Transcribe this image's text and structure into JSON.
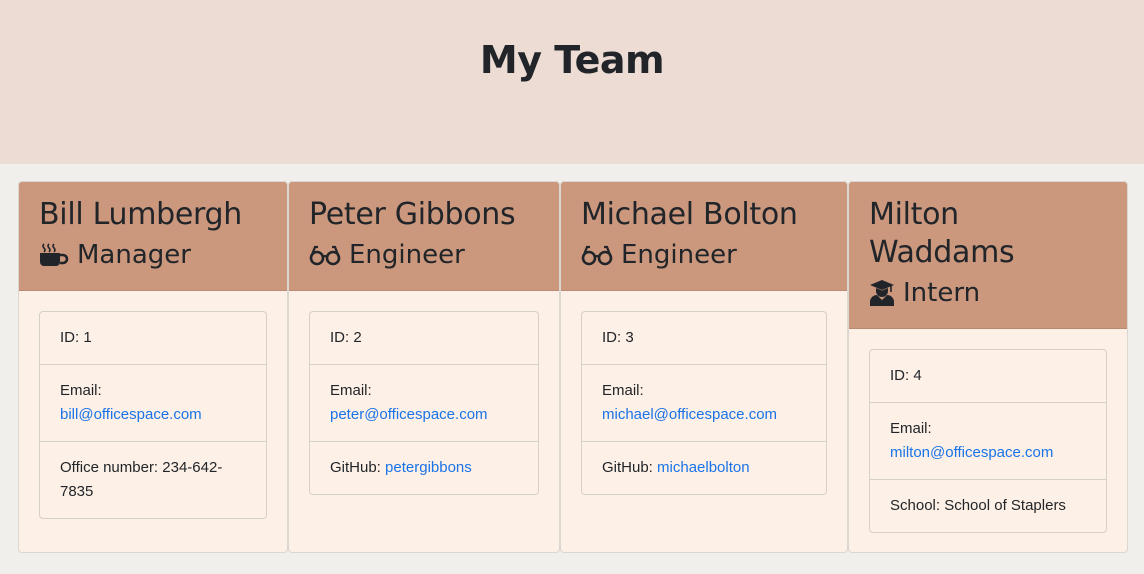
{
  "header": {
    "title": "My Team"
  },
  "cards": [
    {
      "name": "Bill Lumbergh",
      "role": "Manager",
      "role_icon": "coffee-mug-icon",
      "id_text": "ID: 1",
      "email_label": "Email:",
      "email": "bill@officespace.com",
      "extra_label": "Office number: 234-642-7835",
      "extra_link": ""
    },
    {
      "name": "Peter Gibbons",
      "role": "Engineer",
      "role_icon": "glasses-icon",
      "id_text": "ID: 2",
      "email_label": "Email:",
      "email": "peter@officespace.com",
      "extra_label": "GitHub: ",
      "extra_link": "petergibbons"
    },
    {
      "name": "Michael Bolton",
      "role": "Engineer",
      "role_icon": "glasses-icon",
      "id_text": "ID: 3",
      "email_label": "Email:",
      "email": "michael@officespace.com",
      "extra_label": "GitHub: ",
      "extra_link": "michaelbolton"
    },
    {
      "name": "Milton Waddams",
      "role": "Intern",
      "role_icon": "graduate-icon",
      "id_text": "ID: 4",
      "email_label": "Email:",
      "email": "milton@officespace.com",
      "extra_label": "School: School of Staplers",
      "extra_link": ""
    }
  ],
  "colors": {
    "header_bg": "#ecdcd3",
    "card_head_bg": "#cb977d",
    "card_body_bg": "#fdf0e6",
    "link": "#1a73e8"
  }
}
